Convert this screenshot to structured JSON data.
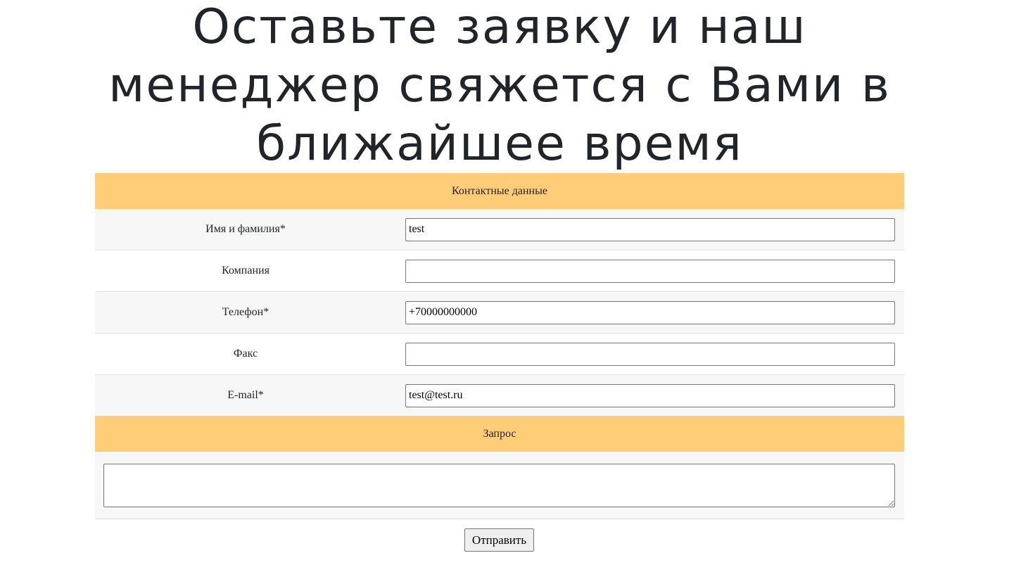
{
  "page": {
    "title": "Оставьте заявку и наш менеджер свяжется с Вами в ближайшее время"
  },
  "form": {
    "contact_section_label": "Контактные данные",
    "fields": [
      {
        "label": "Имя и фамилия*",
        "value": "test"
      },
      {
        "label": "Компания",
        "value": ""
      },
      {
        "label": "Телефон*",
        "value": "+70000000000"
      },
      {
        "label": "Факс",
        "value": ""
      },
      {
        "label": "E-mail*",
        "value": "test@test.ru"
      }
    ],
    "request_section_label": "Запрос",
    "request_value": "",
    "submit_label": "Отправить"
  },
  "colors": {
    "section_header_bg": "#ffcc77",
    "striped_row_bg": "#f7f7f7",
    "text": "#212529"
  }
}
